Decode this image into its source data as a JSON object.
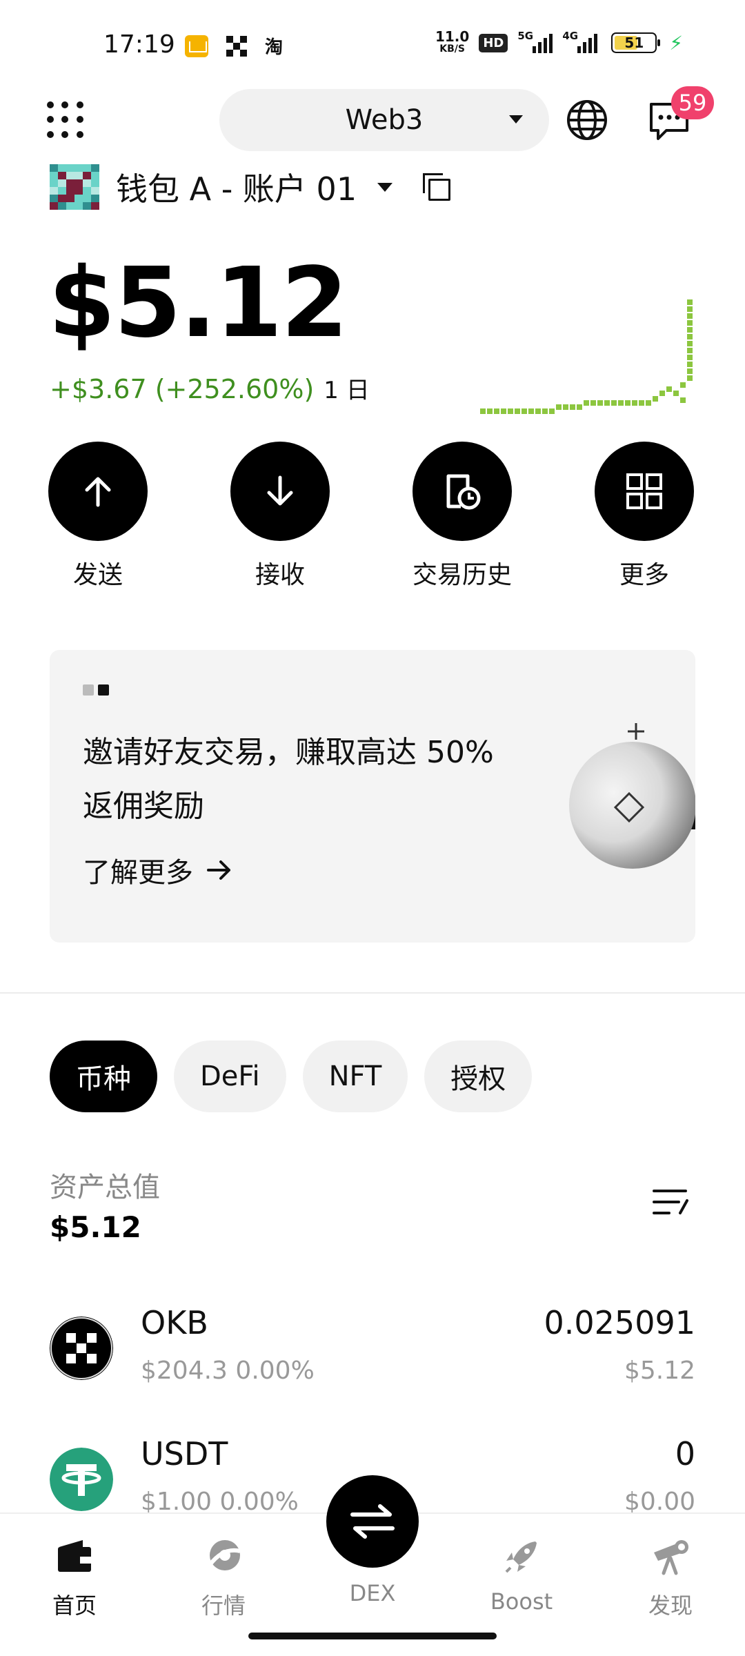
{
  "status_bar": {
    "time": "17:19",
    "taobao_icon": "淘",
    "net_speed_value": "11.0",
    "net_speed_unit": "KB/S",
    "hd_label": "HD",
    "signal1_label": "5G",
    "signal2_label": "4G",
    "battery_level": "51"
  },
  "header": {
    "network_label": "Web3",
    "notification_count": "59"
  },
  "account": {
    "name": "钱包 A - 账户 01"
  },
  "balance": {
    "amount": "$5.12",
    "change": "+$3.67 (+252.60%)",
    "period": "1 日",
    "sparkline_color": "#8cc63f"
  },
  "actions": [
    {
      "label": "发送",
      "icon": "arrow-up-icon"
    },
    {
      "label": "接收",
      "icon": "arrow-down-icon"
    },
    {
      "label": "交易历史",
      "icon": "history-icon"
    },
    {
      "label": "更多",
      "icon": "grid-icon"
    }
  ],
  "promo": {
    "title": "邀请好友交易，赚取高达 50% 返佣奖励",
    "link": "了解更多"
  },
  "tabs": [
    {
      "label": "币种",
      "active": true
    },
    {
      "label": "DeFi",
      "active": false
    },
    {
      "label": "NFT",
      "active": false
    },
    {
      "label": "授权",
      "active": false
    }
  ],
  "assets": {
    "total_label": "资产总值",
    "total_value": "$5.12"
  },
  "tokens": [
    {
      "name": "OKB",
      "price_change": "$204.3 0.00%",
      "amount": "0.025091",
      "usd_value": "$5.12",
      "icon": "okb-icon"
    },
    {
      "name": "USDT",
      "price_change": "$1.00 0.00%",
      "amount": "0",
      "usd_value": "$0.00",
      "icon": "usdt-icon"
    }
  ],
  "bottom_nav": [
    {
      "label": "首页",
      "icon": "wallet-icon",
      "active": true
    },
    {
      "label": "行情",
      "icon": "market-icon",
      "active": false
    },
    {
      "label": "DEX",
      "icon": "swap-icon",
      "active": false
    },
    {
      "label": "Boost",
      "icon": "rocket-icon",
      "active": false
    },
    {
      "label": "发现",
      "icon": "telescope-icon",
      "active": false
    }
  ],
  "colors": {
    "positive": "#3f8f1f",
    "badge": "#f0416c",
    "usdt": "#26a17b"
  }
}
